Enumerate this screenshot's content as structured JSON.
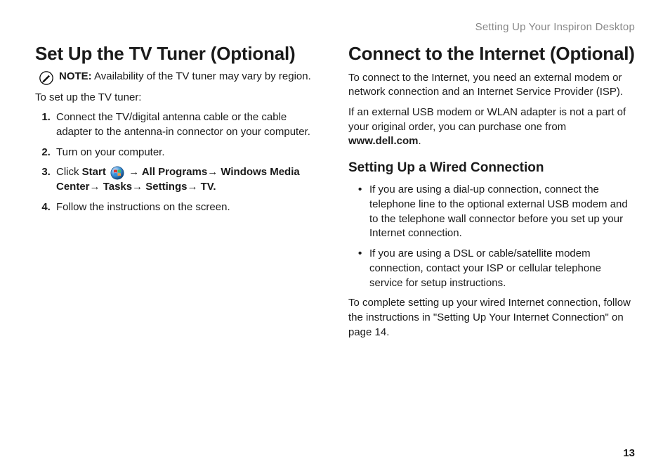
{
  "runningHeader": "Setting Up Your Inspiron Desktop",
  "left": {
    "heading": "Set Up the TV Tuner (Optional)",
    "noteLabel": "NOTE:",
    "noteText": " Availability of the TV tuner may vary by region.",
    "intro": "To set up the TV tuner:",
    "step1": "Connect the TV/digital antenna cable or the cable adapter to the antenna-in connector on your computer.",
    "step2": "Turn on your computer.",
    "step3_prefix": "Click ",
    "step3_start": "Start",
    "step3_arrow1": " → ",
    "step3_allPrograms": "All Programs",
    "step3_arrow2": "→ ",
    "step3_wmc": "Windows Media Center",
    "step3_arrow3": "→ ",
    "step3_tasks": "Tasks",
    "step3_arrow4": "→ ",
    "step3_settings": "Settings",
    "step3_arrow5": "→ ",
    "step3_tv": "TV.",
    "step4": "Follow the instructions on the screen."
  },
  "right": {
    "heading": "Connect to the Internet (Optional)",
    "p1": "To connect to the Internet, you need an external modem or network connection and an Internet Service Provider (ISP).",
    "p2a": "If an external USB modem or WLAN adapter is not a part of your original order, you can purchase one from ",
    "p2b": "www.dell.com",
    "p2c": ".",
    "subheading": "Setting Up a Wired Connection",
    "bullet1": "If you are using a dial-up connection, connect the telephone line to the optional external USB modem and to the telephone wall connector before you set up your Internet connection.",
    "bullet2": "If you are using a DSL or cable/satellite modem connection, contact your ISP or cellular telephone service for setup instructions.",
    "p3": "To complete setting up your wired Internet connection, follow the instructions in \"Setting Up Your Internet Connection\" on page 14."
  },
  "pageNumber": "13"
}
